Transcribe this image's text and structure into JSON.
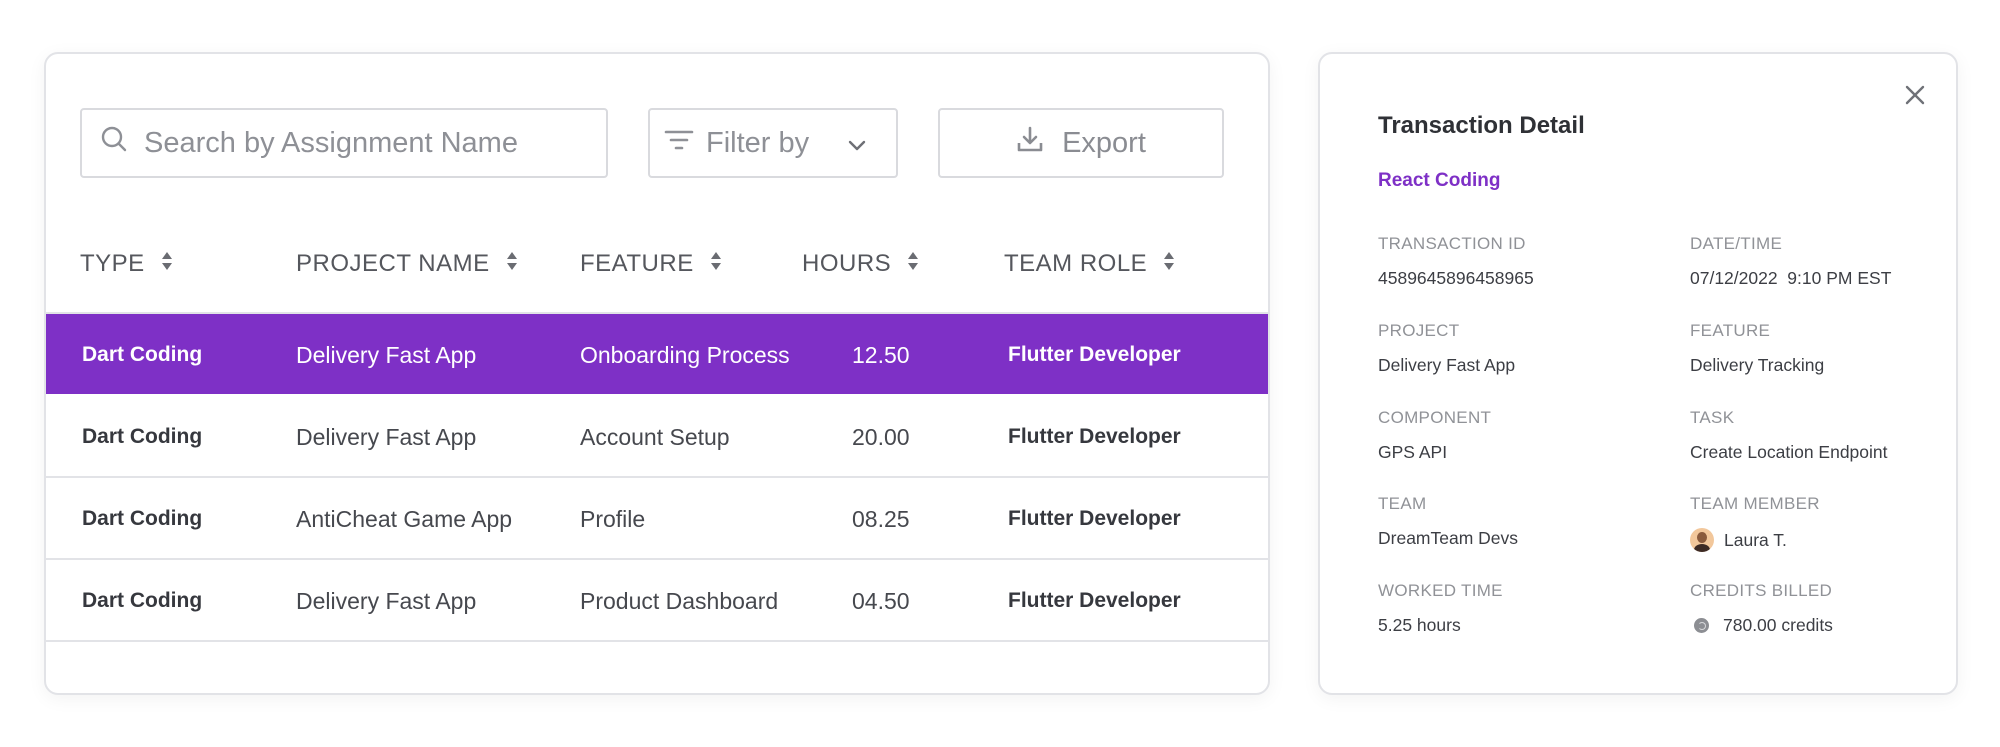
{
  "toolbar": {
    "search_placeholder": "Search by Assignment Name",
    "filter_label": "Filter by",
    "export_label": "Export"
  },
  "table": {
    "columns": [
      "TYPE",
      "PROJECT NAME",
      "FEATURE",
      "HOURS",
      "TEAM ROLE"
    ],
    "rows": [
      {
        "type": "Dart Coding",
        "project": "Delivery Fast App",
        "feature": "Onboarding Process",
        "hours": "12.50",
        "role": "Flutter Developer",
        "selected": true
      },
      {
        "type": "Dart Coding",
        "project": "Delivery Fast App",
        "feature": "Account Setup",
        "hours": "20.00",
        "role": "Flutter Developer",
        "selected": false
      },
      {
        "type": "Dart Coding",
        "project": "AntiCheat Game App",
        "feature": "Profile",
        "hours": "08.25",
        "role": "Flutter Developer",
        "selected": false
      },
      {
        "type": "Dart Coding",
        "project": "Delivery Fast App",
        "feature": "Product Dashboard",
        "hours": "04.50",
        "role": "Flutter Developer",
        "selected": false
      }
    ]
  },
  "detail": {
    "title": "Transaction Detail",
    "subtitle": "React Coding",
    "fields": {
      "transaction_id": {
        "label": "TRANSACTION ID",
        "value": "4589645896458965"
      },
      "datetime": {
        "label": "DATE/TIME",
        "value": "07/12/2022  9:10 PM EST"
      },
      "project": {
        "label": "PROJECT",
        "value": "Delivery Fast App"
      },
      "feature": {
        "label": "FEATURE",
        "value": "Delivery Tracking"
      },
      "component": {
        "label": "COMPONENT",
        "value": "GPS API"
      },
      "task": {
        "label": "TASK",
        "value": "Create Location Endpoint"
      },
      "team": {
        "label": "TEAM",
        "value": "DreamTeam Devs"
      },
      "team_member": {
        "label": "TEAM MEMBER",
        "value": "Laura T."
      },
      "worked_time": {
        "label": "WORKED TIME",
        "value": "5.25 hours"
      },
      "credits_billed": {
        "label": "CREDITS BILLED",
        "value": "780.00 credits"
      }
    }
  },
  "colors": {
    "accent": "#7e30c6",
    "border": "#e2e3e7",
    "text": "#3f4147",
    "muted": "#909297"
  },
  "icons": [
    "search-icon",
    "filter-icon",
    "chevron-down-icon",
    "download-icon",
    "sort-icon",
    "close-icon",
    "coin-icon"
  ]
}
